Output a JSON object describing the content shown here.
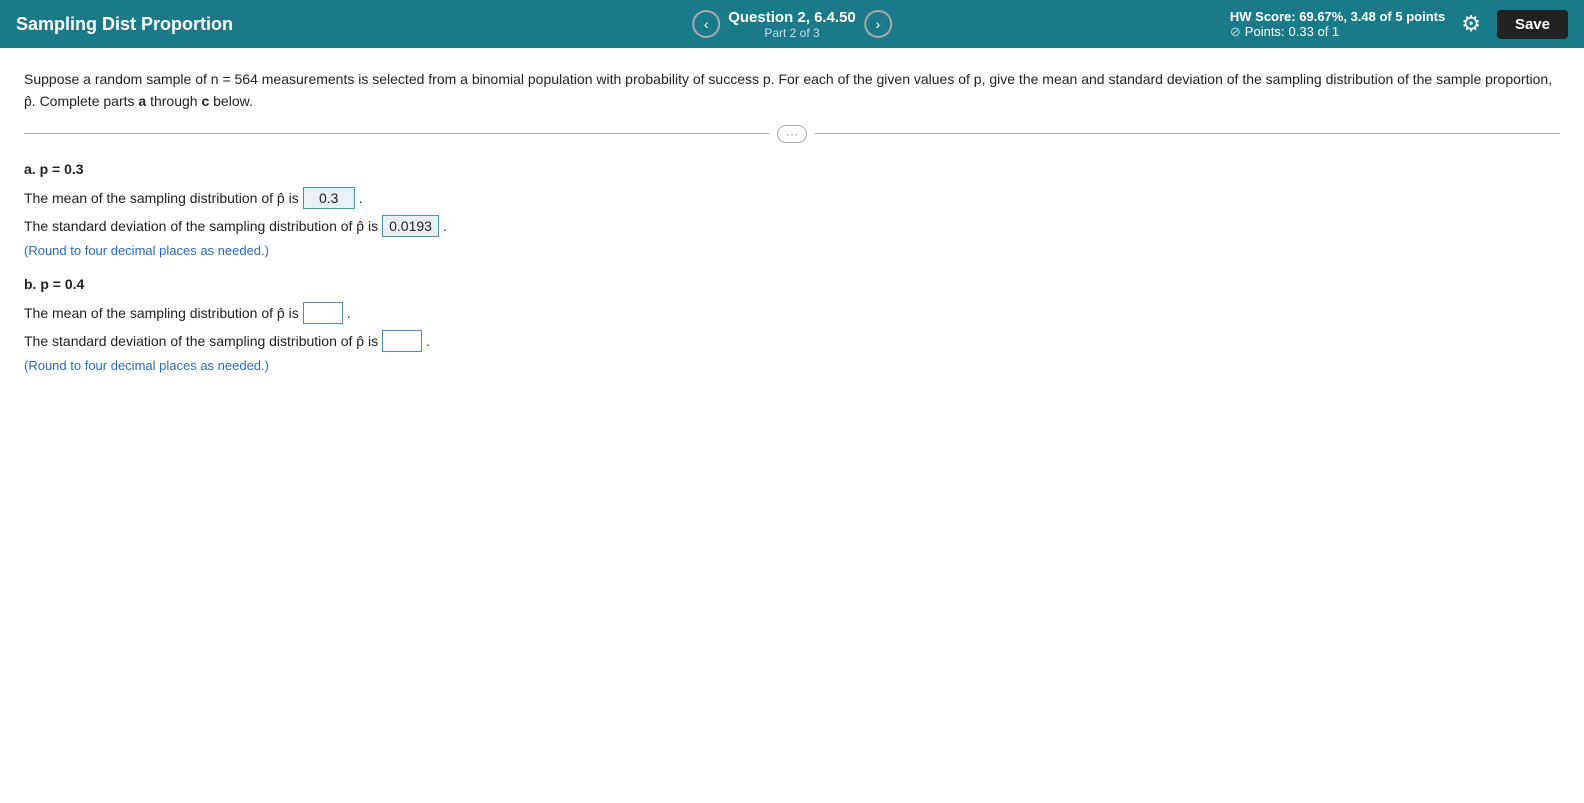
{
  "header": {
    "title": "Sampling Dist Proportion",
    "question": "Question 2, 6.4.50",
    "part": "Part 2 of 3",
    "hw_score_label": "HW Score:",
    "hw_score_value": "69.67%, 3.48 of 5 points",
    "points_label": "Points:",
    "points_value": "0.33 of 1",
    "save_label": "Save",
    "nav_prev": "‹",
    "nav_next": "›",
    "gear_icon": "⚙"
  },
  "problem": {
    "text": "Suppose a random sample of n = 564 measurements is selected from a binomial population with probability of success p. For each of the given values of p, give the mean and standard deviation of the sampling distribution of the sample proportion, p̂. Complete parts",
    "bold_a": "a",
    "through": "through",
    "bold_c": "c",
    "below": "below."
  },
  "divider_dots": "···",
  "parts": [
    {
      "id": "a",
      "label": "a.",
      "p_value": "p = 0.3",
      "mean_prefix": "The mean of the sampling distribution of p̂ is",
      "mean_value": "0.3",
      "mean_suffix": ".",
      "std_prefix": "The standard deviation of the sampling distribution of p̂ is",
      "std_value": "0.0193",
      "std_suffix": ".",
      "round_note": "(Round to four decimal places as needed.)",
      "is_answered": true
    },
    {
      "id": "b",
      "label": "b.",
      "p_value": "p = 0.4",
      "mean_prefix": "The mean of the sampling distribution of p̂ is",
      "mean_value": "",
      "mean_suffix": ".",
      "std_prefix": "The standard deviation of the sampling distribution of p̂ is",
      "std_value": "",
      "std_suffix": ".",
      "round_note": "(Round to four decimal places as needed.)",
      "is_answered": false
    }
  ]
}
